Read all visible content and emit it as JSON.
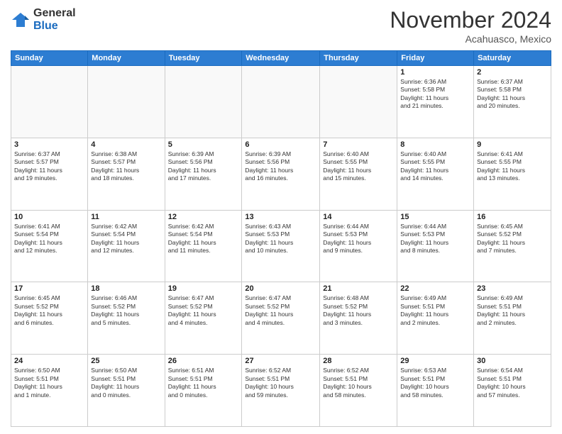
{
  "logo": {
    "general": "General",
    "blue": "Blue"
  },
  "header": {
    "month": "November 2024",
    "location": "Acahuasco, Mexico"
  },
  "weekdays": [
    "Sunday",
    "Monday",
    "Tuesday",
    "Wednesday",
    "Thursday",
    "Friday",
    "Saturday"
  ],
  "weeks": [
    [
      {
        "day": "",
        "info": ""
      },
      {
        "day": "",
        "info": ""
      },
      {
        "day": "",
        "info": ""
      },
      {
        "day": "",
        "info": ""
      },
      {
        "day": "",
        "info": ""
      },
      {
        "day": "1",
        "info": "Sunrise: 6:36 AM\nSunset: 5:58 PM\nDaylight: 11 hours\nand 21 minutes."
      },
      {
        "day": "2",
        "info": "Sunrise: 6:37 AM\nSunset: 5:58 PM\nDaylight: 11 hours\nand 20 minutes."
      }
    ],
    [
      {
        "day": "3",
        "info": "Sunrise: 6:37 AM\nSunset: 5:57 PM\nDaylight: 11 hours\nand 19 minutes."
      },
      {
        "day": "4",
        "info": "Sunrise: 6:38 AM\nSunset: 5:57 PM\nDaylight: 11 hours\nand 18 minutes."
      },
      {
        "day": "5",
        "info": "Sunrise: 6:39 AM\nSunset: 5:56 PM\nDaylight: 11 hours\nand 17 minutes."
      },
      {
        "day": "6",
        "info": "Sunrise: 6:39 AM\nSunset: 5:56 PM\nDaylight: 11 hours\nand 16 minutes."
      },
      {
        "day": "7",
        "info": "Sunrise: 6:40 AM\nSunset: 5:55 PM\nDaylight: 11 hours\nand 15 minutes."
      },
      {
        "day": "8",
        "info": "Sunrise: 6:40 AM\nSunset: 5:55 PM\nDaylight: 11 hours\nand 14 minutes."
      },
      {
        "day": "9",
        "info": "Sunrise: 6:41 AM\nSunset: 5:55 PM\nDaylight: 11 hours\nand 13 minutes."
      }
    ],
    [
      {
        "day": "10",
        "info": "Sunrise: 6:41 AM\nSunset: 5:54 PM\nDaylight: 11 hours\nand 12 minutes."
      },
      {
        "day": "11",
        "info": "Sunrise: 6:42 AM\nSunset: 5:54 PM\nDaylight: 11 hours\nand 12 minutes."
      },
      {
        "day": "12",
        "info": "Sunrise: 6:42 AM\nSunset: 5:54 PM\nDaylight: 11 hours\nand 11 minutes."
      },
      {
        "day": "13",
        "info": "Sunrise: 6:43 AM\nSunset: 5:53 PM\nDaylight: 11 hours\nand 10 minutes."
      },
      {
        "day": "14",
        "info": "Sunrise: 6:44 AM\nSunset: 5:53 PM\nDaylight: 11 hours\nand 9 minutes."
      },
      {
        "day": "15",
        "info": "Sunrise: 6:44 AM\nSunset: 5:53 PM\nDaylight: 11 hours\nand 8 minutes."
      },
      {
        "day": "16",
        "info": "Sunrise: 6:45 AM\nSunset: 5:52 PM\nDaylight: 11 hours\nand 7 minutes."
      }
    ],
    [
      {
        "day": "17",
        "info": "Sunrise: 6:45 AM\nSunset: 5:52 PM\nDaylight: 11 hours\nand 6 minutes."
      },
      {
        "day": "18",
        "info": "Sunrise: 6:46 AM\nSunset: 5:52 PM\nDaylight: 11 hours\nand 5 minutes."
      },
      {
        "day": "19",
        "info": "Sunrise: 6:47 AM\nSunset: 5:52 PM\nDaylight: 11 hours\nand 4 minutes."
      },
      {
        "day": "20",
        "info": "Sunrise: 6:47 AM\nSunset: 5:52 PM\nDaylight: 11 hours\nand 4 minutes."
      },
      {
        "day": "21",
        "info": "Sunrise: 6:48 AM\nSunset: 5:52 PM\nDaylight: 11 hours\nand 3 minutes."
      },
      {
        "day": "22",
        "info": "Sunrise: 6:49 AM\nSunset: 5:51 PM\nDaylight: 11 hours\nand 2 minutes."
      },
      {
        "day": "23",
        "info": "Sunrise: 6:49 AM\nSunset: 5:51 PM\nDaylight: 11 hours\nand 2 minutes."
      }
    ],
    [
      {
        "day": "24",
        "info": "Sunrise: 6:50 AM\nSunset: 5:51 PM\nDaylight: 11 hours\nand 1 minute."
      },
      {
        "day": "25",
        "info": "Sunrise: 6:50 AM\nSunset: 5:51 PM\nDaylight: 11 hours\nand 0 minutes."
      },
      {
        "day": "26",
        "info": "Sunrise: 6:51 AM\nSunset: 5:51 PM\nDaylight: 11 hours\nand 0 minutes."
      },
      {
        "day": "27",
        "info": "Sunrise: 6:52 AM\nSunset: 5:51 PM\nDaylight: 10 hours\nand 59 minutes."
      },
      {
        "day": "28",
        "info": "Sunrise: 6:52 AM\nSunset: 5:51 PM\nDaylight: 10 hours\nand 58 minutes."
      },
      {
        "day": "29",
        "info": "Sunrise: 6:53 AM\nSunset: 5:51 PM\nDaylight: 10 hours\nand 58 minutes."
      },
      {
        "day": "30",
        "info": "Sunrise: 6:54 AM\nSunset: 5:51 PM\nDaylight: 10 hours\nand 57 minutes."
      }
    ]
  ]
}
